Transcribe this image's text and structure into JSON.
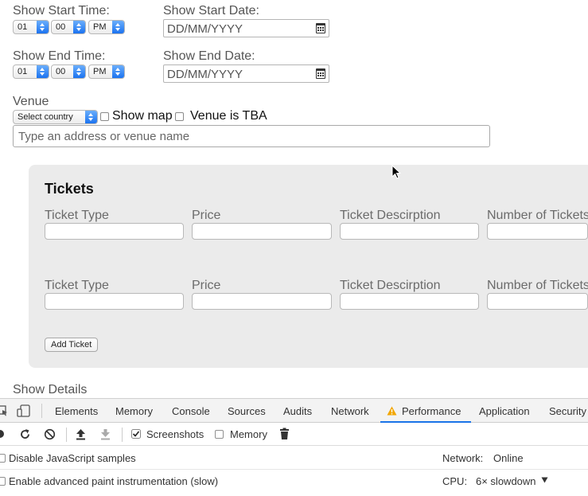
{
  "form": {
    "start_time": {
      "label": "Show Start Time:",
      "hour": "01",
      "minute": "00",
      "ampm": "PM"
    },
    "start_date": {
      "label": "Show Start Date:",
      "placeholder": "DD/MM/YYYY"
    },
    "end_time": {
      "label": "Show End Time:",
      "hour": "01",
      "minute": "00",
      "ampm": "PM"
    },
    "end_date": {
      "label": "Show End Date:",
      "placeholder": "DD/MM/YYYY"
    },
    "venue": {
      "label": "Venue",
      "country_select": "Select country",
      "show_map_label": "Show map",
      "tba_label": "Venue is TBA",
      "address_placeholder": "Type an address or venue name"
    },
    "tickets": {
      "title": "Tickets",
      "rows": [
        {
          "type": "Ticket Type",
          "price": "Price",
          "description": "Ticket Descirption",
          "number": "Number of Tickets"
        },
        {
          "type": "Ticket Type",
          "price": "Price",
          "description": "Ticket Descirption",
          "number": "Number of Tickets"
        }
      ],
      "add_button": "Add Ticket"
    },
    "show_details_label": "Show Details"
  },
  "devtools": {
    "tabs": [
      "Elements",
      "Memory",
      "Console",
      "Sources",
      "Audits",
      "Network",
      "Performance",
      "Application",
      "Security"
    ],
    "active_tab": "Performance",
    "toolbar": {
      "screenshots_label": "Screenshots",
      "memory_label": "Memory"
    },
    "settings": {
      "disable_js_samples": "Disable JavaScript samples",
      "advanced_paint": "Enable advanced paint instrumentation (slow)",
      "network_label": "Network:",
      "network_value": "Online",
      "cpu_label": "CPU:",
      "cpu_value": "6× slowdown"
    },
    "colors": {
      "active_tab_accent": "#1a73e8",
      "warning": "#f2a600"
    }
  }
}
